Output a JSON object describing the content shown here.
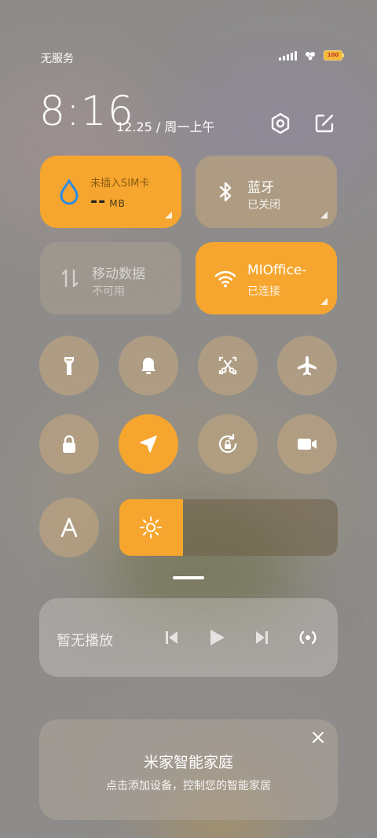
{
  "status": {
    "carrier": "无服务",
    "battery": "100"
  },
  "clock": {
    "time": "8:16",
    "date": "12.25 / 周一上午"
  },
  "tiles": {
    "sim": {
      "label": "未插入SIM卡",
      "value": "--",
      "unit": "MB"
    },
    "bluetooth": {
      "title": "蓝牙",
      "status": "已关闭"
    },
    "mobile_data": {
      "title": "移动数据",
      "status": "不可用"
    },
    "wifi": {
      "title": "MIOffice-",
      "status": "已连接"
    }
  },
  "brightness": {
    "level": 0.29
  },
  "media": {
    "label": "暂无播放"
  },
  "smart_home": {
    "title": "米家智能家庭",
    "subtitle": "点击添加设备，控制您的智能家居"
  },
  "colors": {
    "accent": "#f6a62e"
  }
}
